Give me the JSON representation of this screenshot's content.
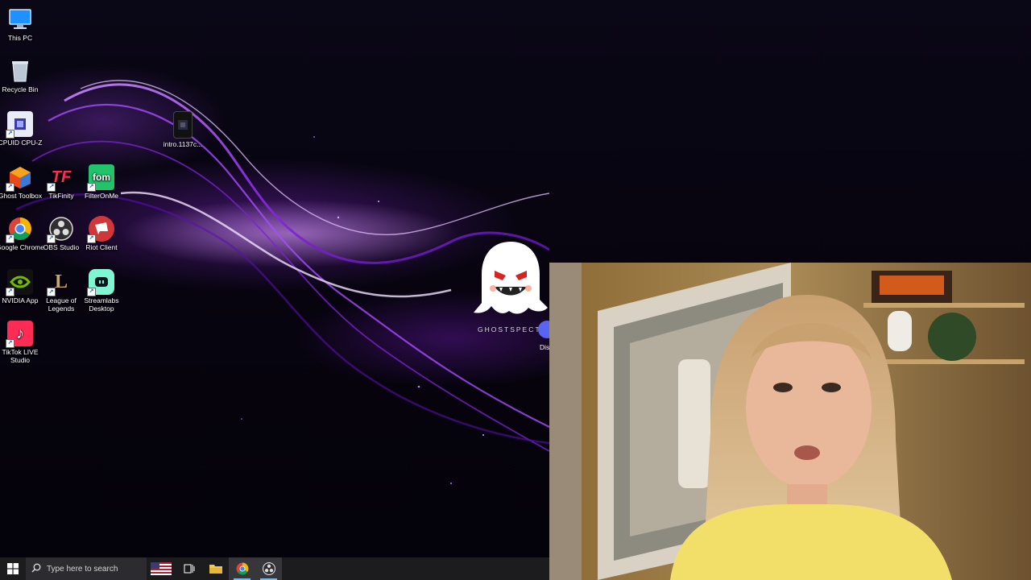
{
  "desktop": {
    "icons": [
      {
        "name": "This PC",
        "icon": "this-pc-icon"
      },
      {
        "name": "Recycle Bin",
        "icon": "recycle-bin-icon"
      },
      {
        "name": "CPUID CPU-Z",
        "icon": "cpu-z-icon"
      },
      {
        "name": "intro.1137c...",
        "icon": "video-file-icon"
      },
      {
        "name": "Ghost Toolbox",
        "icon": "ghost-toolbox-icon"
      },
      {
        "name": "TikFinity",
        "icon": "tikfinity-icon",
        "glyph": "TF"
      },
      {
        "name": "FilterOnMe",
        "icon": "filteronme-icon",
        "glyph": "fom"
      },
      {
        "name": "Google Chrome",
        "icon": "chrome-icon"
      },
      {
        "name": "OBS Studio",
        "icon": "obs-icon"
      },
      {
        "name": "Riot Client",
        "icon": "riot-client-icon"
      },
      {
        "name": "NVIDIA App",
        "icon": "nvidia-icon"
      },
      {
        "name": "League of Legends",
        "icon": "league-of-legends-icon",
        "glyph": "L"
      },
      {
        "name": "Streamlabs Desktop",
        "icon": "streamlabs-icon"
      },
      {
        "name": "TikTok LIVE Studio",
        "icon": "tiktok-live-icon",
        "glyph": "♪"
      }
    ],
    "overlay_logo_text": "GHOSTSPECT",
    "partial_icon_label": "Dis"
  },
  "webcam": {
    "description_icon": "webcam-person-icon"
  },
  "taskbar": {
    "search_placeholder": "Type here to search",
    "apps": [
      "task-view-icon",
      "file-explorer-icon",
      "chrome-icon",
      "obs-icon"
    ]
  },
  "colors": {
    "taskbar": "#1c1c1f",
    "accent": "#76b9ed",
    "wallpaper": "#05030d",
    "purple": "#9b3dff"
  }
}
